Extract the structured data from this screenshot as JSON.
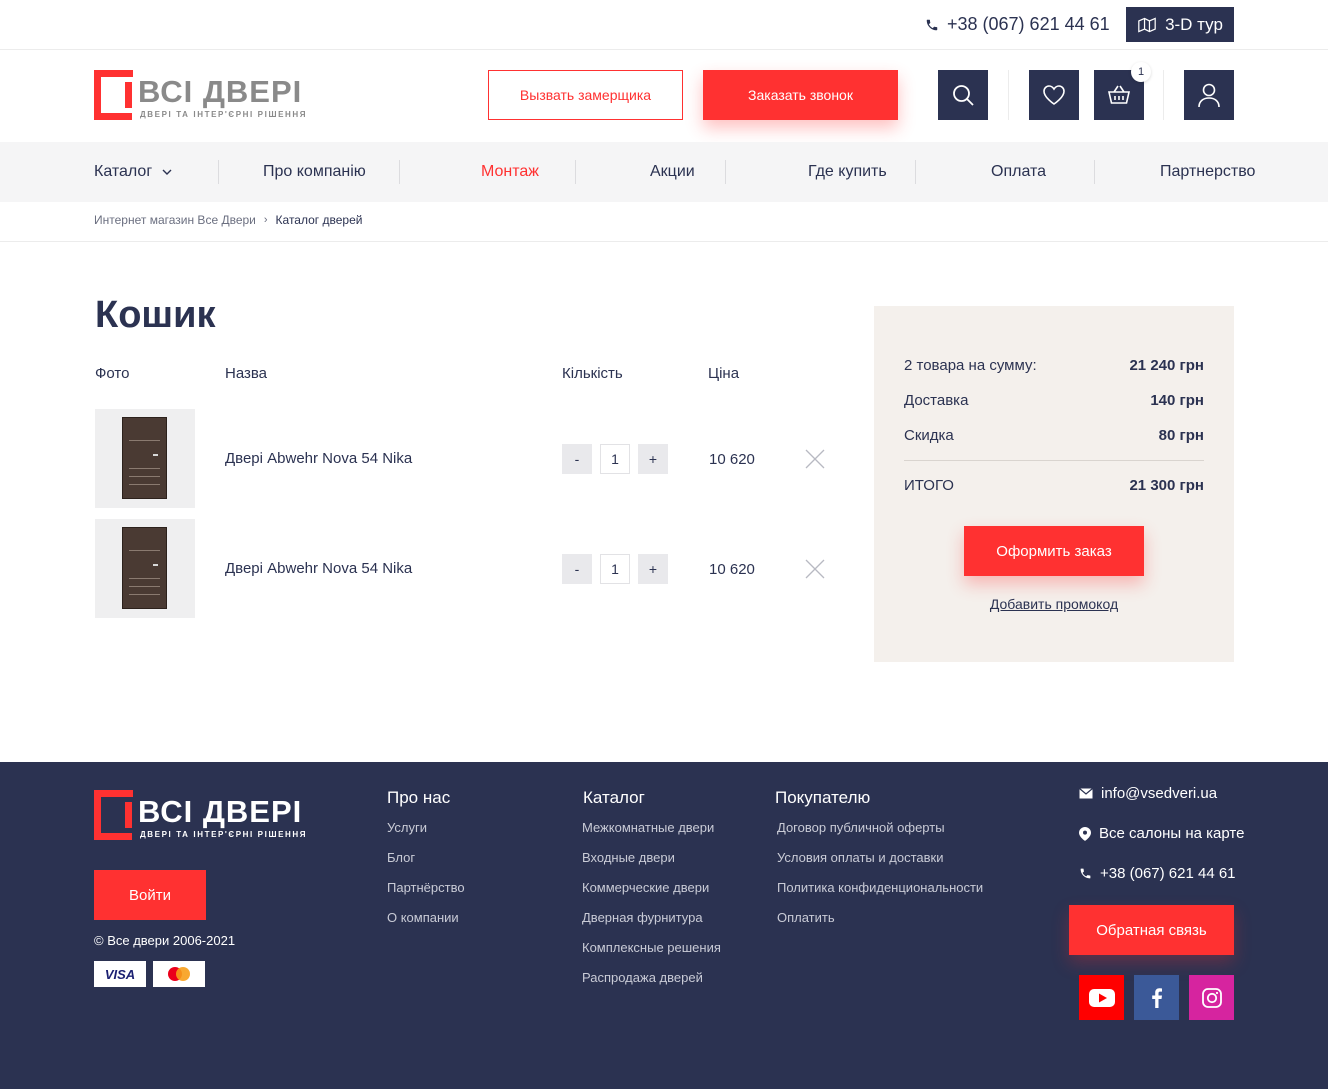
{
  "topbar": {
    "phone": "+38 (067) 621 44 61",
    "tour_label": "3-D тур"
  },
  "header": {
    "logo_text": "ВСІ ДВЕРІ",
    "logo_sub": "ДВЕРІ ТА ІНТЕР'ЄРНІ РІШЕННЯ",
    "measure_label": "Вызвать замерщика",
    "call_label": "Заказать звонок",
    "cart_count": "1",
    "icons": [
      "search-icon",
      "heart-icon",
      "basket-icon",
      "user-icon"
    ]
  },
  "nav": {
    "items": [
      "Каталог",
      "Про компанію",
      "Монтаж",
      "Акции",
      "Где купить",
      "Оплата",
      "Партнерство"
    ],
    "active": "Монтаж"
  },
  "breadcrumb": {
    "home": "Интернет магазин Все Двери",
    "current": "Каталог дверей"
  },
  "cart": {
    "title": "Кошик",
    "columns": [
      "Фото",
      "Назва",
      "Кількість",
      "Ціна"
    ],
    "items": [
      {
        "name": "Двері Abwehr Nova 54 Nika",
        "qty": "1",
        "price": "10 620"
      },
      {
        "name": "Двері Abwehr Nova 54 Nika",
        "qty": "1",
        "price": "10 620"
      }
    ],
    "minus": "-",
    "plus": "+"
  },
  "summary": {
    "rows": [
      {
        "label": "2 товара на сумму:",
        "value": "21 240 грн"
      },
      {
        "label": "Доставка",
        "value": "140 грн"
      },
      {
        "label": "Скидка",
        "value": "80 грн"
      }
    ],
    "total_label": "ИТОГО",
    "total_value": "21 300 грн",
    "order_label": "Оформить заказ",
    "promo_label": "Добавить промокод"
  },
  "footer": {
    "login_label": "Войти",
    "copyright": "© Все двери 2006-2021",
    "payment": [
      "VISA",
      "MasterCard"
    ],
    "about": {
      "title": "Про нас",
      "links": [
        "Услуги",
        "Блог",
        "Партнёрство",
        "О компании"
      ]
    },
    "catalog": {
      "title": "Каталог",
      "links": [
        "Межкомнатные двери",
        "Входные двери",
        "Коммерческие двери",
        "Дверная фурнитура",
        "Комплексные решения",
        "Распродажа дверей"
      ]
    },
    "buyer": {
      "title": "Покупателю",
      "links": [
        "Договор публичной оферты",
        "Условия оплаты и доставки",
        "Политика конфиденциональности",
        "Оплатить"
      ]
    },
    "contacts": {
      "email": "info@vsedveri.ua",
      "salons": "Все салоны на карте",
      "phone": "+38 (067) 621 44 61"
    },
    "feedback_label": "Обратная связь",
    "social": [
      {
        "name": "youtube-icon",
        "color": "#ff0000"
      },
      {
        "name": "facebook-icon",
        "color": "#3b5998"
      },
      {
        "name": "instagram-icon",
        "color": "#d6249f"
      }
    ]
  },
  "colors": {
    "accent": "#ff3131",
    "navy": "#2b3251",
    "summary_bg": "#f4f0ec"
  }
}
